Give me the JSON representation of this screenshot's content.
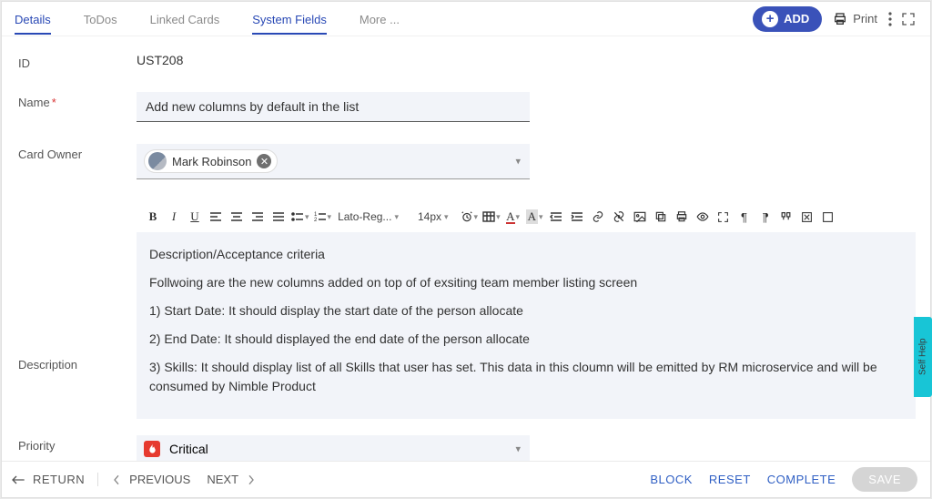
{
  "tabs": {
    "details": "Details",
    "todos": "ToDos",
    "linked": "Linked Cards",
    "system": "System Fields",
    "more": "More ..."
  },
  "actions": {
    "add": "ADD",
    "print": "Print"
  },
  "fields": {
    "id_label": "ID",
    "id_value": "UST208",
    "name_label": "Name",
    "name_value": "Add new columns by default in the list",
    "owner_label": "Card Owner",
    "owner_value": "Mark Robinson",
    "desc_label": "Description",
    "priority_label": "Priority",
    "priority_value": "Critical"
  },
  "rte": {
    "font": "Lato-Reg...",
    "size": "14px",
    "p1": "Description/Acceptance criteria",
    "p2": "Follwoing are the new columns added on top of of exsiting team member listing screen",
    "p3": "1) Start Date: It should display the start date of the person allocate",
    "p4": "2) End Date: It should displayed the end date of the person allocate",
    "p5": "3) Skills: It should display list of all Skills that user has set. This data in this cloumn will be emitted by RM microservice and will be consumed by Nimble Product"
  },
  "footer": {
    "return": "RETURN",
    "previous": "PREVIOUS",
    "next": "NEXT",
    "block": "BLOCK",
    "reset": "RESET",
    "complete": "COMPLETE",
    "save": "SAVE"
  },
  "selfhelp": "Self Help"
}
